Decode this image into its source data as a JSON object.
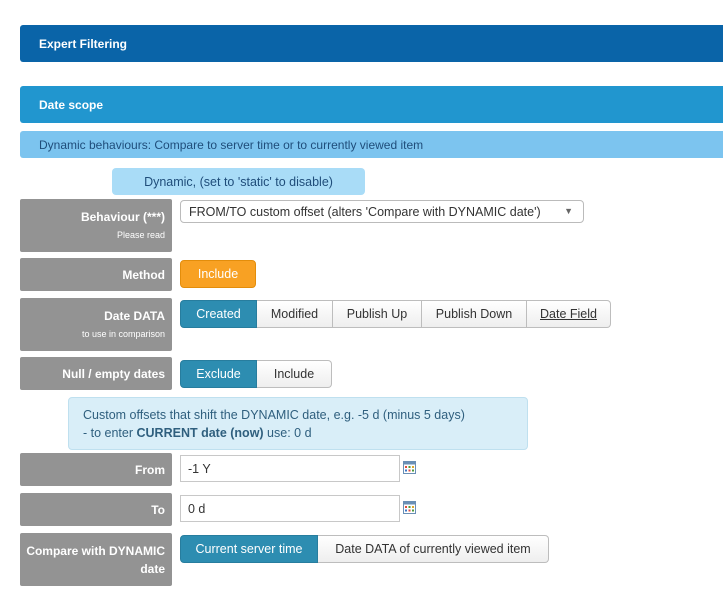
{
  "header": {
    "expert_filtering": "Expert Filtering"
  },
  "section": {
    "date_scope": "Date scope",
    "dynamic_behaviours": "Dynamic behaviours: Compare to server time or to currently viewed item",
    "dynamic_badge": "Dynamic, (set to 'static' to disable)"
  },
  "behaviour": {
    "label": "Behaviour (***)",
    "sub": "Please read",
    "selected": "FROM/TO custom offset (alters 'Compare with DYNAMIC date')"
  },
  "method": {
    "label": "Method",
    "button": "Include"
  },
  "date_data": {
    "label": "Date DATA",
    "sub": "to use in comparison",
    "options": [
      "Created",
      "Modified",
      "Publish Up",
      "Publish Down",
      "Date Field"
    ],
    "selected": "Created"
  },
  "null_dates": {
    "label": "Null / empty dates",
    "options": [
      "Exclude",
      "Include"
    ],
    "selected": "Exclude"
  },
  "info": {
    "line1": "Custom offsets that shift the DYNAMIC date, e.g. -5 d (minus 5 days)",
    "line2_prefix": "- to enter ",
    "line2_bold": "CURRENT date (now)",
    "line2_suffix": " use: 0 d"
  },
  "from": {
    "label": "From",
    "value": "-1 Y"
  },
  "to": {
    "label": "To",
    "value": "0 d"
  },
  "compare": {
    "label": "Compare with DYNAMIC date",
    "options": [
      "Current server time",
      "Date DATA of currently viewed item"
    ],
    "selected": "Current server time"
  },
  "icons": {
    "caret": "caret-down-icon",
    "calendar": "calendar-icon"
  },
  "colors": {
    "expert_bar": "#0a64a8",
    "date_scope_bar": "#2196cf",
    "active_button": "#2d8db1",
    "orange_button": "#f8a123",
    "label_bg": "#939393"
  }
}
